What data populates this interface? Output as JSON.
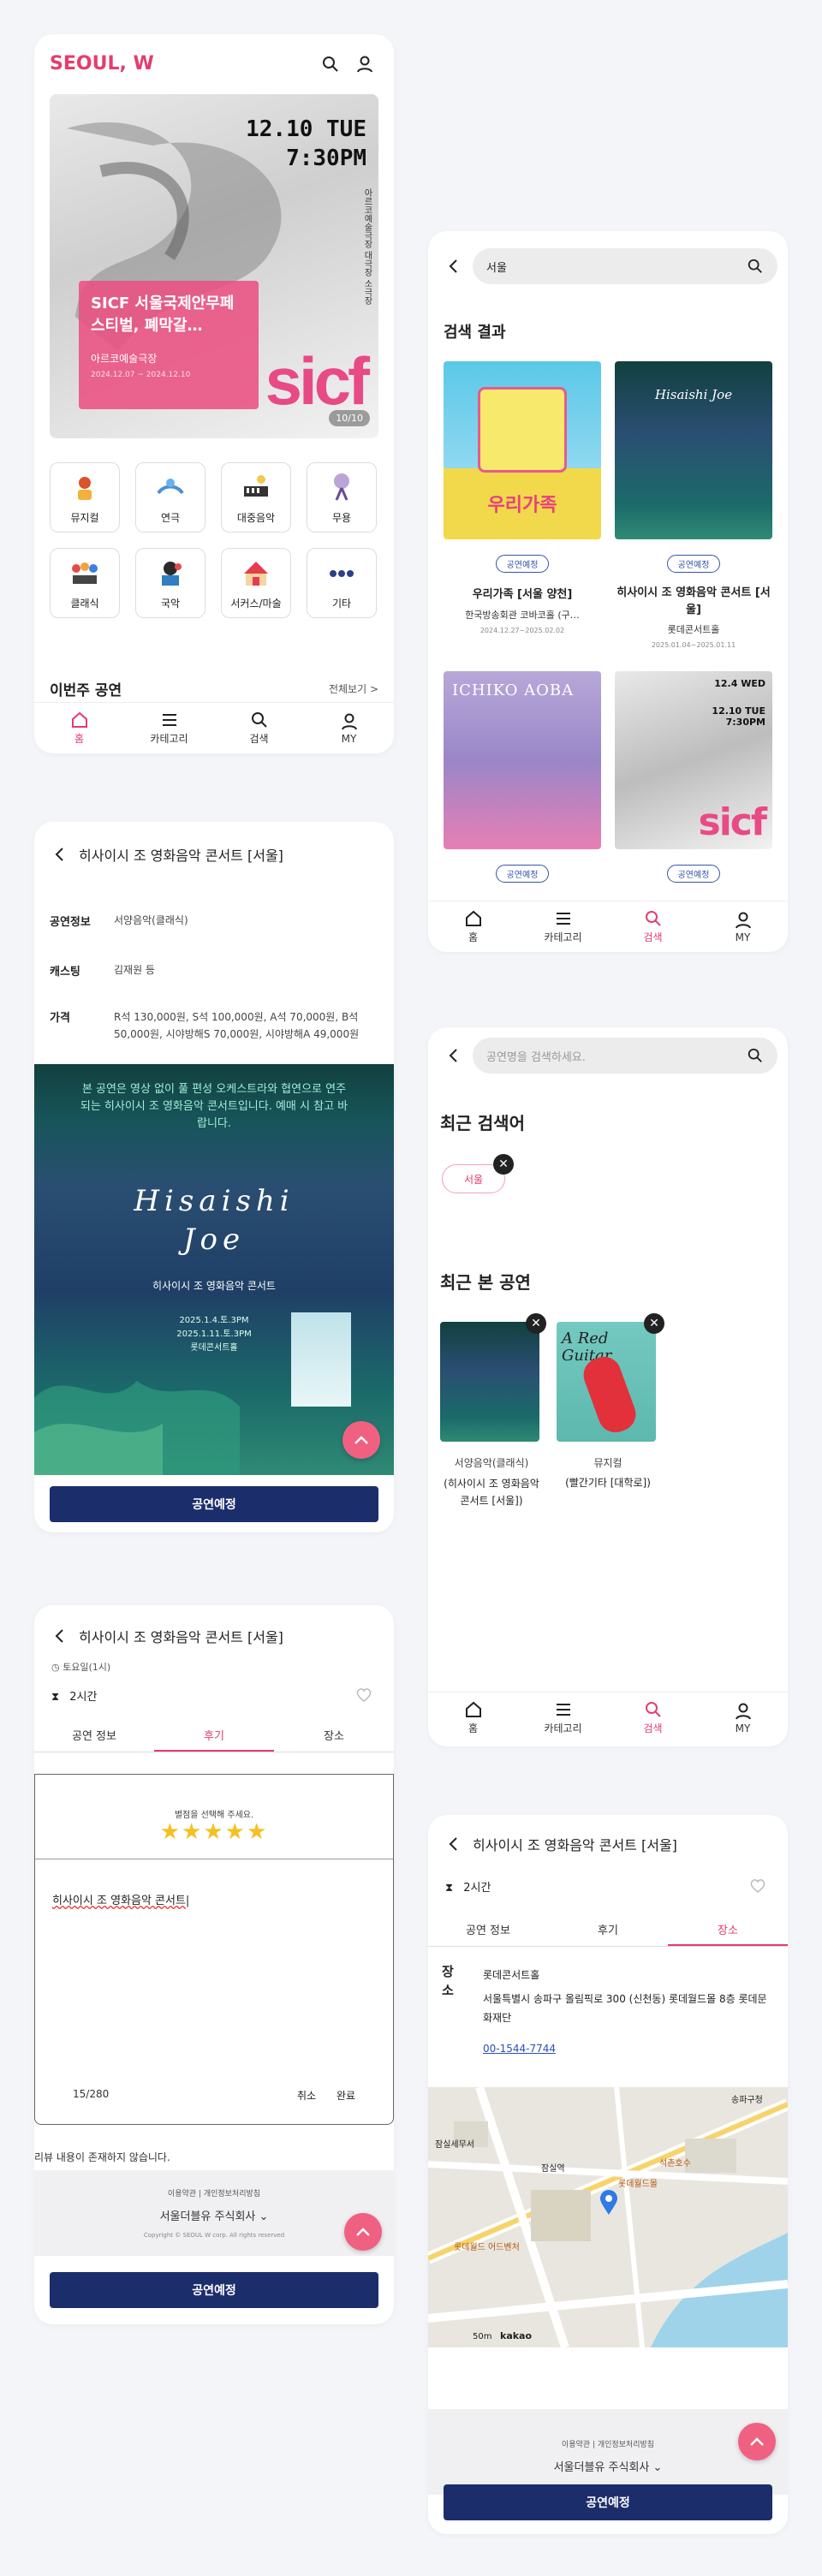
{
  "home": {
    "logo_a": "SEOUL, ",
    "logo_b": "W",
    "banner": {
      "date": "12.10 TUE",
      "time": "7:30PM",
      "title": "SICF 서울국제안무페스티벌, 폐막갈…",
      "venue": "아르코예술극장",
      "dates": "2024.12.07 ~ 2024.12.10",
      "counter": "10/10",
      "side": "아르코예술극장 대극장 소극장",
      "logo": "sicf"
    },
    "categories": [
      "뮤지컬",
      "연극",
      "대중음악",
      "무용",
      "클래식",
      "국악",
      "서커스/마술",
      "기타"
    ],
    "section": "이번주 공연",
    "more": "전체보기 >"
  },
  "nav": {
    "home": "홈",
    "category": "카테고리",
    "search": "검색",
    "my": "MY"
  },
  "detail": {
    "title": "히사이시 조 영화음악 콘서트 [서울]",
    "rows": [
      {
        "k": "공연정보",
        "v": "서양음악(클래식)"
      },
      {
        "k": "캐스팅",
        "v": "김재원 등"
      },
      {
        "k": "가격",
        "v": "R석 130,000원, S석 100,000원, A석 70,000원, B석 50,000원, 시야방해S 70,000원, 시야방해A 49,000원"
      }
    ],
    "notice": "본 공연은 영상 없이 풀 편성 오케스트라와 협연으로 연주되는 히사이시 조 영화음악 콘서트입니다. 예매 시 참고 바랍니다.",
    "poster": {
      "script1": "Hisaishi",
      "script2": "Joe",
      "name": "히사이시 조 영화음악 콘서트",
      "d1": "2025.1.4.토.3PM",
      "d2": "2025.1.11.토.3PM",
      "venue": "롯데콘서트홀"
    },
    "cta": "공연예정"
  },
  "review": {
    "title": "히사이시 조 영화음악 콘서트 [서울]",
    "partial": "토요일(1시)",
    "duration": "2시간",
    "tabs": [
      "공연 정보",
      "후기",
      "장소"
    ],
    "star_prompt": "별점을 선택해 주세요.",
    "stars": 5,
    "text": "히사이시 조 영화음악 콘서트",
    "count": "15/280",
    "cancel": "취소",
    "done": "완료",
    "empty": "리뷰 내용이 존재하지 않습니다.",
    "footer": {
      "terms": "이용약관",
      "privacy": "개인정보처리방침",
      "company": "서울더블유 주식회사",
      "copy": "Copyright © SEOUL W corp. All rights reserved"
    },
    "cta": "공연예정"
  },
  "search": {
    "query": "서울",
    "heading": "검색 결과",
    "results": [
      {
        "badge": "공연예정",
        "title": "우리가족 [서울 양천]",
        "venue": "한국방송회관 코바코홀 (구…",
        "date": "2024.12.27~2025.02.02",
        "poster_text": "우리가족"
      },
      {
        "badge": "공연예정",
        "title": "히사이시 조 영화음악 콘서트 [서울]",
        "venue": "롯데콘서트홀",
        "date": "2025.01.04~2025.01.11",
        "poster_text": "Hisaishi Joe"
      },
      {
        "badge": "공연예정",
        "poster_text": "ICHIKO AOBA"
      },
      {
        "badge": "공연예정",
        "poster_text": "sicf",
        "date_text": "12.4 WED",
        "date_text2": "12.10 TUE 7:30PM"
      }
    ]
  },
  "recent": {
    "placeholder": "공연명을 검색하세요.",
    "h1": "최근 검색어",
    "chip": "서울",
    "h2": "최근 본 공연",
    "items": [
      {
        "genre": "서양음악(클래식)",
        "title": "(히사이시 조 영화음악 콘서트 [서울])"
      },
      {
        "genre": "뮤지컬",
        "title": "(빨간기타 [대학로])",
        "poster_text": "A Red Guitar"
      }
    ]
  },
  "venue": {
    "title": "히사이시 조 영화음악 콘서트 [서울]",
    "duration": "2시간",
    "tabs": [
      "공연 정보",
      "후기",
      "장소"
    ],
    "label": "장소",
    "name": "롯데콘서트홀",
    "address": "서울특별시 송파구 올림픽로 300 (신천동) 롯데월드몰 8층 롯데문화재단",
    "phone": "00-1544-7744",
    "map_labels": [
      "송파구청",
      "잠실세무서",
      "롯데월드 어드벤처",
      "롯데월드몰",
      "석촌호수",
      "잠실역"
    ],
    "scale": "50m",
    "maplogo": "kakao",
    "footer": {
      "terms": "이용약관",
      "privacy": "개인정보처리방침",
      "company": "서울더블유 주식회사"
    },
    "cta": "공연예정"
  }
}
